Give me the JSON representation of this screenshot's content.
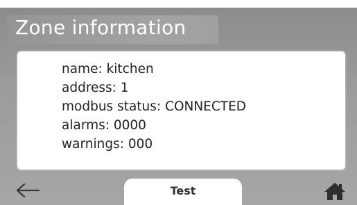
{
  "header": {
    "title": "Zone information"
  },
  "zone": {
    "name_line": "name: kitchen",
    "address_line": "address: 1",
    "modbus_line": "modbus status: CONNECTED",
    "alarms_line": "alarms: 0000",
    "warnings_line": "warnings: 000"
  },
  "footer": {
    "back_icon": "arrow-left-icon",
    "test_label": "Test",
    "home_icon": "home-icon"
  },
  "colors": {
    "background": "#9b9b9b",
    "panel": "#ffffff",
    "text": "#222222",
    "icon": "#333333"
  }
}
